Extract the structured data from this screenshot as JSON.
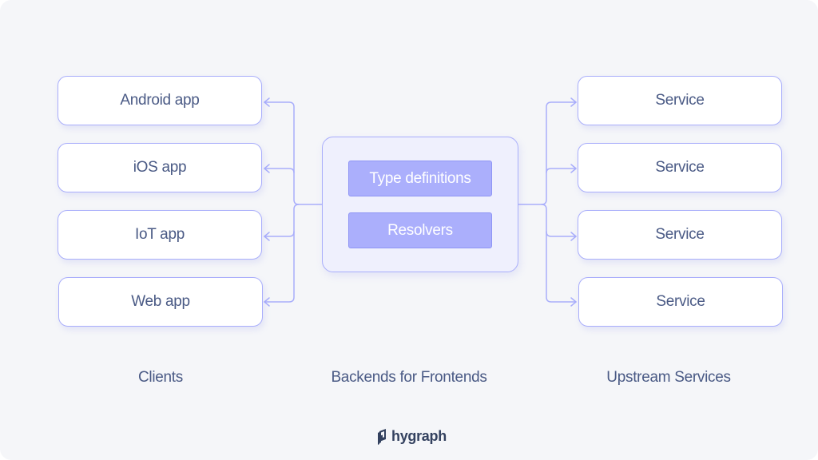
{
  "clients": {
    "items": [
      {
        "label": "Android app"
      },
      {
        "label": "iOS app"
      },
      {
        "label": "IoT app"
      },
      {
        "label": "Web app"
      }
    ],
    "caption": "Clients"
  },
  "bff": {
    "items": [
      {
        "label": "Type definitions"
      },
      {
        "label": "Resolvers"
      }
    ],
    "caption": "Backends for Frontends"
  },
  "services": {
    "items": [
      {
        "label": "Service"
      },
      {
        "label": "Service"
      },
      {
        "label": "Service"
      },
      {
        "label": "Service"
      }
    ],
    "caption": "Upstream Services"
  },
  "brand": {
    "name": "hygraph",
    "icon": "hygraph-logo-icon"
  },
  "colors": {
    "background": "#f5f6f9",
    "node_border": "#a9aefb",
    "bff_fill": "#eff0fd",
    "inner_fill": "#abaffc",
    "text": "#4a5a85",
    "wire": "#a9aefb"
  }
}
